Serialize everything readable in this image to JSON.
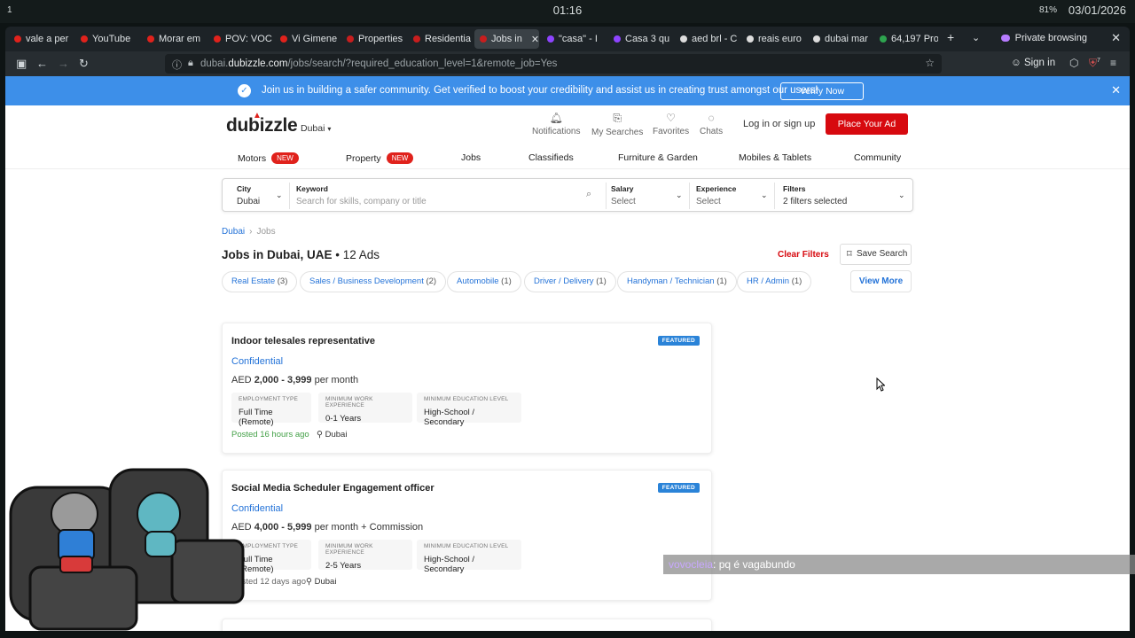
{
  "os": {
    "workspace": "1",
    "clock": "01:16",
    "battery": "81%",
    "date": "03/01/2026"
  },
  "browser": {
    "tabs": [
      {
        "label": "vale a per",
        "color": "#e0221c"
      },
      {
        "label": "YouTube",
        "color": "#e0221c"
      },
      {
        "label": "Morar em",
        "color": "#e0221c"
      },
      {
        "label": "POV: VOC",
        "color": "#e0221c"
      },
      {
        "label": "Vi Gimene",
        "color": "#e0221c"
      },
      {
        "label": "Properties",
        "color": "#c81e1e"
      },
      {
        "label": "Residentia",
        "color": "#c81e1e"
      },
      {
        "label": "Jobs in",
        "color": "#c81e1e",
        "active": true
      },
      {
        "label": "\"casa\" - I",
        "color": "#8e44ff"
      },
      {
        "label": "Casa 3 qu",
        "color": "#8e44ff"
      },
      {
        "label": "aed brl - C",
        "color": "#dddddd"
      },
      {
        "label": "reais euro",
        "color": "#dddddd"
      },
      {
        "label": "dubai mar",
        "color": "#dddddd"
      },
      {
        "label": "64,197 Pro",
        "color": "#2ea44f"
      }
    ],
    "private_label": "Private browsing",
    "url_prefix": "dubai.",
    "url_domain": "dubizzle.com",
    "url_path": "/jobs/search/?required_education_level=1&remote_job=Yes",
    "sign_in": "Sign in",
    "ext_badge": "7"
  },
  "banner": {
    "message": "Join us in building a safer community. Get verified to boost your credibility and assist us in creating trust amongst our users!",
    "verify_label": "Verify Now"
  },
  "header": {
    "logo": "dubizzle",
    "city": "Dubai",
    "notifications": "Notifications",
    "my_searches": "My Searches",
    "favorites": "Favorites",
    "chats": "Chats",
    "login": "Log in or sign up",
    "place_ad": "Place Your Ad"
  },
  "categories": [
    {
      "label": "Motors",
      "badge": "NEW"
    },
    {
      "label": "Property",
      "badge": "NEW"
    },
    {
      "label": "Jobs"
    },
    {
      "label": "Classifieds"
    },
    {
      "label": "Furniture & Garden"
    },
    {
      "label": "Mobiles & Tablets"
    },
    {
      "label": "Community"
    }
  ],
  "search": {
    "city_label": "City",
    "city_value": "Dubai",
    "keyword_label": "Keyword",
    "keyword_placeholder": "Search for skills, company or title",
    "salary_label": "Salary",
    "salary_value": "Select",
    "experience_label": "Experience",
    "experience_value": "Select",
    "filters_label": "Filters",
    "filters_value": "2 filters selected"
  },
  "breadcrumb": {
    "home": "Dubai",
    "current": "Jobs"
  },
  "results": {
    "title": "Jobs in Dubai, UAE",
    "count": "12 Ads",
    "clear_filters": "Clear Filters",
    "save_search": "Save Search",
    "view_more": "View More",
    "pills": [
      {
        "label": "Real Estate",
        "count": "(3)"
      },
      {
        "label": "Sales / Business Development",
        "count": "(2)"
      },
      {
        "label": "Automobile",
        "count": "(1)"
      },
      {
        "label": "Driver / Delivery",
        "count": "(1)"
      },
      {
        "label": "Handyman / Technician",
        "count": "(1)"
      },
      {
        "label": "HR / Admin",
        "count": "(1)"
      }
    ]
  },
  "listings": [
    {
      "title": "Indoor telesales representative",
      "featured": "FEATURED",
      "company": "Confidential",
      "currency": "AED",
      "salary": "2,000 - 3,999",
      "salary_suffix": "per month",
      "emp_label": "EMPLOYMENT TYPE",
      "emp_value": "Full Time (Remote)",
      "exp_label": "MINIMUM WORK EXPERIENCE",
      "exp_value": "0-1 Years",
      "edu_label": "MINIMUM EDUCATION LEVEL",
      "edu_value": "High-School / Secondary",
      "posted_prefix": "Posted",
      "posted_time": "16 hours ago",
      "location": "Dubai"
    },
    {
      "title": "Social Media Scheduler Engagement officer",
      "featured": "FEATURED",
      "company": "Confidential",
      "currency": "AED",
      "salary": "4,000 - 5,999",
      "salary_suffix": "per month + Commission",
      "emp_label": "EMPLOYMENT TYPE",
      "emp_value": "Full Time (Remote)",
      "exp_label": "MINIMUM WORK EXPERIENCE",
      "exp_value": "2-5 Years",
      "edu_label": "MINIMUM EDUCATION LEVEL",
      "edu_value": "High-School / Secondary",
      "posted_prefix": "Posted",
      "posted_time": "12 days ago",
      "location": "Dubai"
    }
  ],
  "chat": {
    "user": "vovocleia",
    "message": ": pq é vagabundo"
  }
}
